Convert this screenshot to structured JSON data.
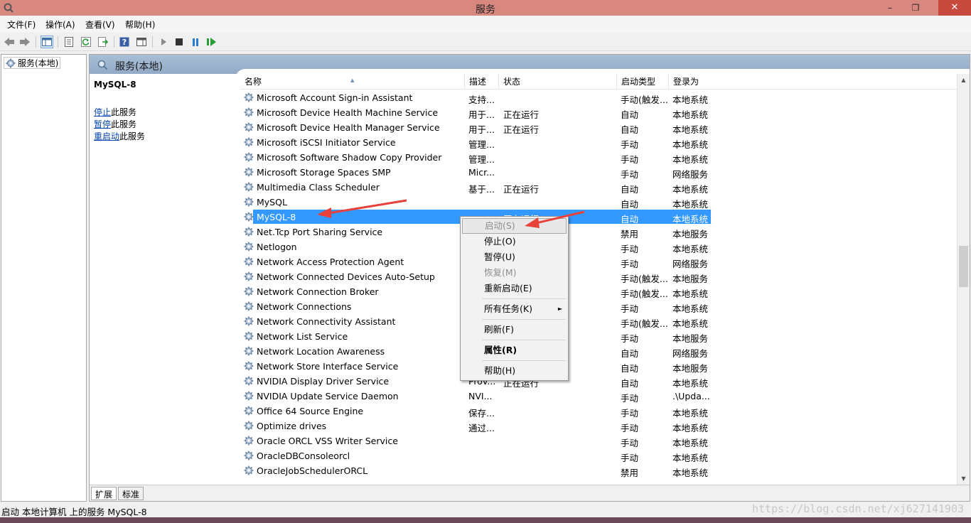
{
  "window": {
    "title": "服务",
    "buttons": {
      "minimize": "–",
      "maximize": "❐",
      "close": "✕"
    }
  },
  "menubar": {
    "items": [
      "文件(F)",
      "操作(A)",
      "查看(V)",
      "帮助(H)"
    ]
  },
  "toolbar": {
    "icons": [
      "back-arrow-icon",
      "forward-arrow-icon",
      "show-hide-console-tree-icon",
      "properties-icon",
      "refresh-icon",
      "export-list-icon",
      "help-icon",
      "show-hide-action-pane-icon",
      "start-service-icon",
      "stop-service-icon",
      "pause-service-icon",
      "restart-service-icon"
    ]
  },
  "tree": {
    "root_label": "服务(本地)"
  },
  "main": {
    "header_title": "服务(本地)",
    "desc": {
      "service_name": "MySQL-8",
      "actions": [
        {
          "link": "停止",
          "suffix": "此服务"
        },
        {
          "link": "暂停",
          "suffix": "此服务"
        },
        {
          "link": "重启动",
          "suffix": "此服务"
        }
      ]
    },
    "columns": {
      "name": "名称",
      "description": "描述",
      "status": "状态",
      "startup_type": "启动类型",
      "logon_as": "登录为"
    },
    "services": [
      {
        "name": "Microsoft Account Sign-in Assistant",
        "description": "支持...",
        "status": "",
        "startup": "手动(触发...",
        "logon": "本地系统"
      },
      {
        "name": "Microsoft Device Health Machine Service",
        "description": "用于...",
        "status": "正在运行",
        "startup": "自动",
        "logon": "本地系统"
      },
      {
        "name": "Microsoft Device Health Manager Service",
        "description": "用于...",
        "status": "正在运行",
        "startup": "自动",
        "logon": "本地系统"
      },
      {
        "name": "Microsoft iSCSI Initiator Service",
        "description": "管理...",
        "status": "",
        "startup": "手动",
        "logon": "本地系统"
      },
      {
        "name": "Microsoft Software Shadow Copy Provider",
        "description": "管理...",
        "status": "",
        "startup": "手动",
        "logon": "本地系统"
      },
      {
        "name": "Microsoft Storage Spaces SMP",
        "description": "Micr...",
        "status": "",
        "startup": "手动",
        "logon": "网络服务"
      },
      {
        "name": "Multimedia Class Scheduler",
        "description": "基于...",
        "status": "正在运行",
        "startup": "自动",
        "logon": "本地系统"
      },
      {
        "name": "MySQL",
        "description": "",
        "status": "",
        "startup": "自动",
        "logon": "本地系统"
      },
      {
        "name": "MySQL-8",
        "description": "",
        "status": "正在运行",
        "startup": "自动",
        "logon": "本地系统",
        "selected": true
      },
      {
        "name": "Net.Tcp Port Sharing Service",
        "description": "",
        "status": "",
        "startup": "禁用",
        "logon": "本地服务"
      },
      {
        "name": "Netlogon",
        "description": "",
        "status": "",
        "startup": "手动",
        "logon": "本地系统"
      },
      {
        "name": "Network Access Protection Agent",
        "description": "",
        "status": "",
        "startup": "手动",
        "logon": "网络服务"
      },
      {
        "name": "Network Connected Devices Auto-Setup",
        "description": "",
        "status": "",
        "startup": "手动(触发...",
        "logon": "本地服务"
      },
      {
        "name": "Network Connection Broker",
        "description": "",
        "status": "",
        "startup": "手动(触发...",
        "logon": "本地系统"
      },
      {
        "name": "Network Connections",
        "description": "",
        "status": "",
        "startup": "手动",
        "logon": "本地系统"
      },
      {
        "name": "Network Connectivity Assistant",
        "description": "",
        "status": "",
        "startup": "手动(触发...",
        "logon": "本地系统"
      },
      {
        "name": "Network List Service",
        "description": "",
        "status": "",
        "startup": "手动",
        "logon": "本地服务"
      },
      {
        "name": "Network Location Awareness",
        "description": "",
        "status": "",
        "startup": "自动",
        "logon": "网络服务"
      },
      {
        "name": "Network Store Interface Service",
        "description": "",
        "status": "",
        "startup": "自动",
        "logon": "本地服务"
      },
      {
        "name": "NVIDIA Display Driver Service",
        "description": "Prov...",
        "status": "正在运行",
        "startup": "自动",
        "logon": "本地系统"
      },
      {
        "name": "NVIDIA Update Service Daemon",
        "description": "NVI...",
        "status": "",
        "startup": "手动",
        "logon": ".\\Upda..."
      },
      {
        "name": "Office 64 Source Engine",
        "description": "保存...",
        "status": "",
        "startup": "手动",
        "logon": "本地系统"
      },
      {
        "name": "Optimize drives",
        "description": "通过...",
        "status": "",
        "startup": "手动",
        "logon": "本地系统"
      },
      {
        "name": "Oracle ORCL VSS Writer Service",
        "description": "",
        "status": "",
        "startup": "手动",
        "logon": "本地系统"
      },
      {
        "name": "OracleDBConsoleorcl",
        "description": "",
        "status": "",
        "startup": "手动",
        "logon": "本地系统"
      },
      {
        "name": "OracleJobSchedulerORCL",
        "description": "",
        "status": "",
        "startup": "禁用",
        "logon": "本地系统"
      }
    ],
    "tabs": [
      "扩展",
      "标准"
    ]
  },
  "context_menu": {
    "items": [
      {
        "label": "启动(S)",
        "disabled": true,
        "hover": true
      },
      {
        "label": "停止(O)"
      },
      {
        "label": "暂停(U)"
      },
      {
        "label": "恢复(M)",
        "disabled": true
      },
      {
        "label": "重新启动(E)"
      },
      {
        "separator": true
      },
      {
        "label": "所有任务(K)",
        "submenu": true
      },
      {
        "separator": true
      },
      {
        "label": "刷新(F)"
      },
      {
        "separator": true
      },
      {
        "label": "属性(R)",
        "bold": true
      },
      {
        "separator": true
      },
      {
        "label": "帮助(H)"
      }
    ],
    "submenu_arrow": "►"
  },
  "statusbar": {
    "text": "启动 本地计算机 上的服务 MySQL-8"
  },
  "watermark": "https://blog.csdn.net/xj627141903",
  "colors": {
    "titlebar": "#d98880",
    "selection": "#3399ff",
    "annotation_arrow": "#e8413a",
    "link": "#0645ad"
  }
}
